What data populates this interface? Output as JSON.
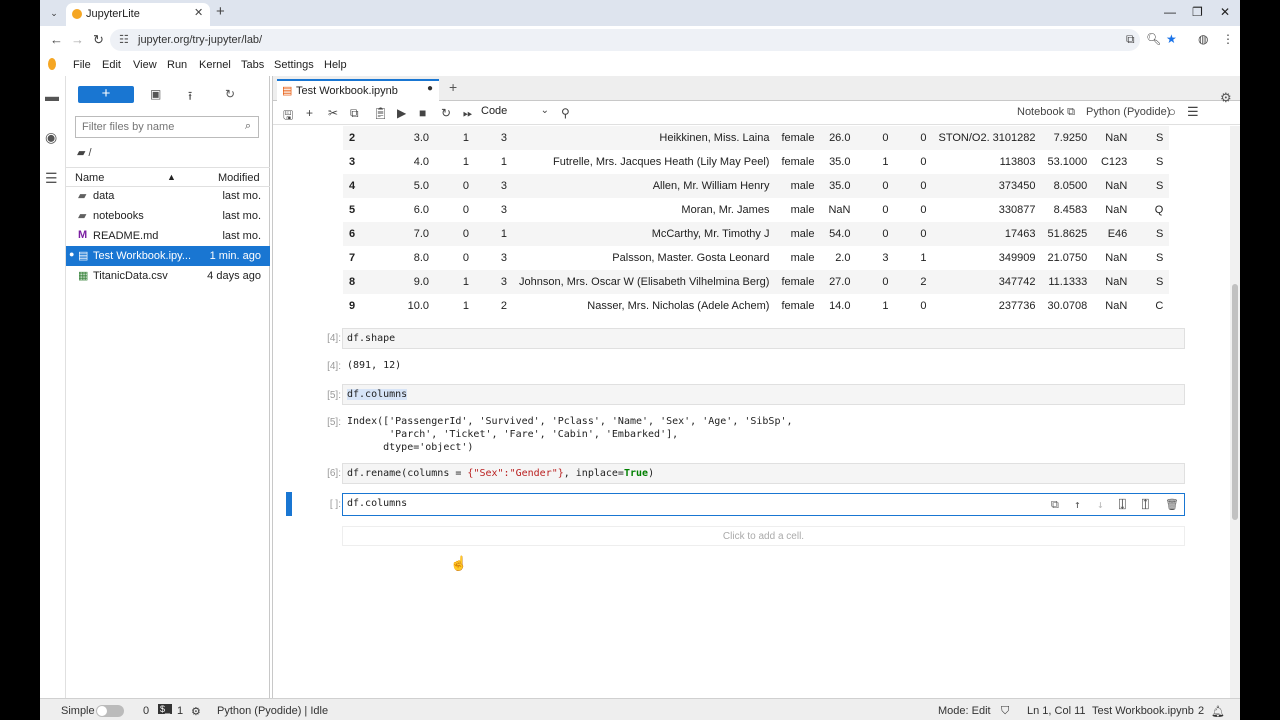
{
  "browser": {
    "tab_title": "JupyterLite",
    "url": "jupyter.org/try-jupyter/lab/"
  },
  "menu": [
    "File",
    "Edit",
    "View",
    "Run",
    "Kernel",
    "Tabs",
    "Settings",
    "Help"
  ],
  "filebrowser": {
    "filter_placeholder": "Filter files by name",
    "breadcrumb": "/",
    "col_name": "Name",
    "col_modified": "Modified",
    "items": [
      {
        "name": "data",
        "modified": "last mo.",
        "icon": "folder-icon"
      },
      {
        "name": "notebooks",
        "modified": "last mo.",
        "icon": "folder-icon"
      },
      {
        "name": "README.md",
        "modified": "last mo.",
        "icon": "markdown-icon"
      },
      {
        "name": "Test Workbook.ipy...",
        "modified": "1 min. ago",
        "icon": "notebook-icon"
      },
      {
        "name": "TitanicData.csv",
        "modified": "4 days ago",
        "icon": "spreadsheet-icon"
      }
    ]
  },
  "notebook": {
    "tab_title": "Test Workbook.ipynb",
    "cell_type": "Code",
    "notebook_label": "Notebook",
    "kernel": "Python (Pyodide)",
    "df_rows": [
      [
        "2",
        "3.0",
        "1",
        "3",
        "Heikkinen, Miss. Laina",
        "female",
        "26.0",
        "0",
        "0",
        "STON/O2. 3101282",
        "7.9250",
        "NaN",
        "S"
      ],
      [
        "3",
        "4.0",
        "1",
        "1",
        "Futrelle, Mrs. Jacques Heath (Lily May Peel)",
        "female",
        "35.0",
        "1",
        "0",
        "113803",
        "53.1000",
        "C123",
        "S"
      ],
      [
        "4",
        "5.0",
        "0",
        "3",
        "Allen, Mr. William Henry",
        "male",
        "35.0",
        "0",
        "0",
        "373450",
        "8.0500",
        "NaN",
        "S"
      ],
      [
        "5",
        "6.0",
        "0",
        "3",
        "Moran, Mr. James",
        "male",
        "NaN",
        "0",
        "0",
        "330877",
        "8.4583",
        "NaN",
        "Q"
      ],
      [
        "6",
        "7.0",
        "0",
        "1",
        "McCarthy, Mr. Timothy J",
        "male",
        "54.0",
        "0",
        "0",
        "17463",
        "51.8625",
        "E46",
        "S"
      ],
      [
        "7",
        "8.0",
        "0",
        "3",
        "Palsson, Master. Gosta Leonard",
        "male",
        "2.0",
        "3",
        "1",
        "349909",
        "21.0750",
        "NaN",
        "S"
      ],
      [
        "8",
        "9.0",
        "1",
        "3",
        "Johnson, Mrs. Oscar W (Elisabeth Vilhelmina Berg)",
        "female",
        "27.0",
        "0",
        "2",
        "347742",
        "11.1333",
        "NaN",
        "S"
      ],
      [
        "9",
        "10.0",
        "1",
        "2",
        "Nasser, Mrs. Nicholas (Adele Achem)",
        "female",
        "14.0",
        "1",
        "0",
        "237736",
        "30.0708",
        "NaN",
        "C"
      ]
    ],
    "cells": {
      "c4_in_prompt": "[4]:",
      "c4_code": "df.shape",
      "c4_out_prompt": "[4]:",
      "c4_output": "(891, 12)",
      "c5_in_prompt": "[5]:",
      "c5_code": "df.columns",
      "c5_out_prompt": "[5]:",
      "c5_output_1": "Index(['PassengerId', 'Survived', 'Pclass', 'Name', 'Sex', 'Age', 'SibSp',",
      "c5_output_2": "       'Parch', 'Ticket', 'Fare', 'Cabin', 'Embarked'],",
      "c5_output_3": "      dtype='object')",
      "c6_in_prompt": "[6]:",
      "c6_code_a": "df.rename(columns = ",
      "c6_code_b": "{\"Sex\":\"Gender\"}",
      "c6_code_c": ", inplace=",
      "c6_code_d": "True",
      "c6_code_e": ")",
      "c7_in_prompt": "[ ]:",
      "c7_code": "df.columns"
    },
    "add_cell": "Click to add a cell."
  },
  "status": {
    "simple": "Simple",
    "count1": "0",
    "count2": "1",
    "kernel_status": "Python (Pyodide) | Idle",
    "mode": "Mode: Edit",
    "position": "Ln 1, Col 11",
    "file": "Test Workbook.ipynb",
    "notifications": "2"
  }
}
